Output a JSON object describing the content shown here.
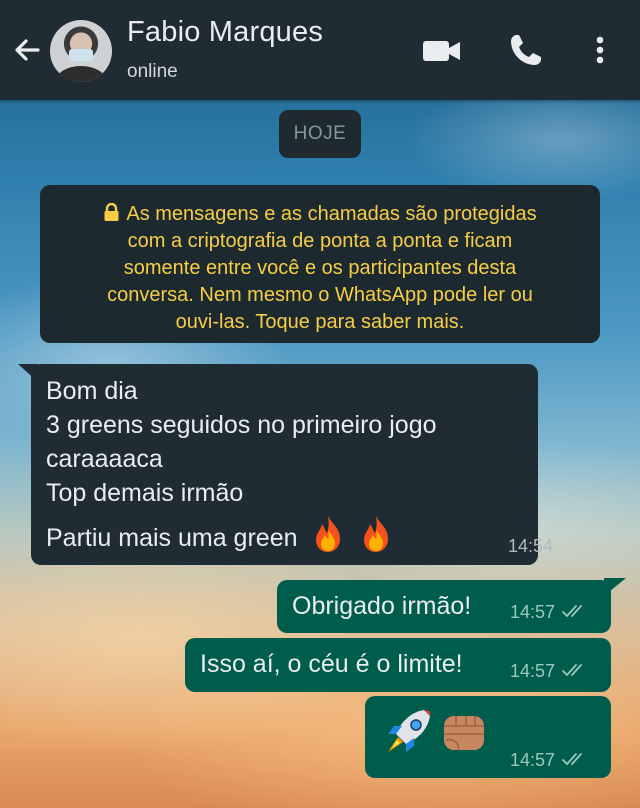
{
  "header": {
    "contact_name": "Fabio Marques",
    "status": "online",
    "background_color": "#1f2c34",
    "icons": [
      "back-arrow-icon",
      "video-call-icon",
      "phone-icon",
      "more-vert-icon"
    ]
  },
  "chat": {
    "date_chip": "HOJE",
    "encryption_notice": {
      "lines": [
        "As mensagens e as chamadas são protegidas",
        "com a criptografia de ponta a ponta e ficam",
        "somente entre você e os participantes desta",
        "conversa. Nem mesmo o WhatsApp pode ler ou",
        "ouvi-las. Toque para saber mais."
      ],
      "color": "#f7cd46",
      "icon": "lock-icon"
    },
    "messages": [
      {
        "direction": "incoming",
        "lines": [
          "Bom dia",
          "3 greens seguidos no primeiro jogo",
          "caraaaaca",
          "Top demais irmão",
          "Partiu mais uma green"
        ],
        "emojis": [
          "fire",
          "fire"
        ],
        "time": "14:54"
      },
      {
        "direction": "outgoing",
        "text": "Obrigado irmão!",
        "time": "14:57",
        "status": "read-ticks"
      },
      {
        "direction": "outgoing",
        "text": "Isso aí, o céu é o limite!",
        "time": "14:57",
        "status": "read-ticks"
      },
      {
        "direction": "outgoing",
        "emojis": [
          "rocket",
          "fist"
        ],
        "time": "14:57",
        "status": "read-ticks"
      }
    ],
    "colors": {
      "incoming_bubble": "#202c33",
      "outgoing_bubble": "#005c4b"
    }
  }
}
